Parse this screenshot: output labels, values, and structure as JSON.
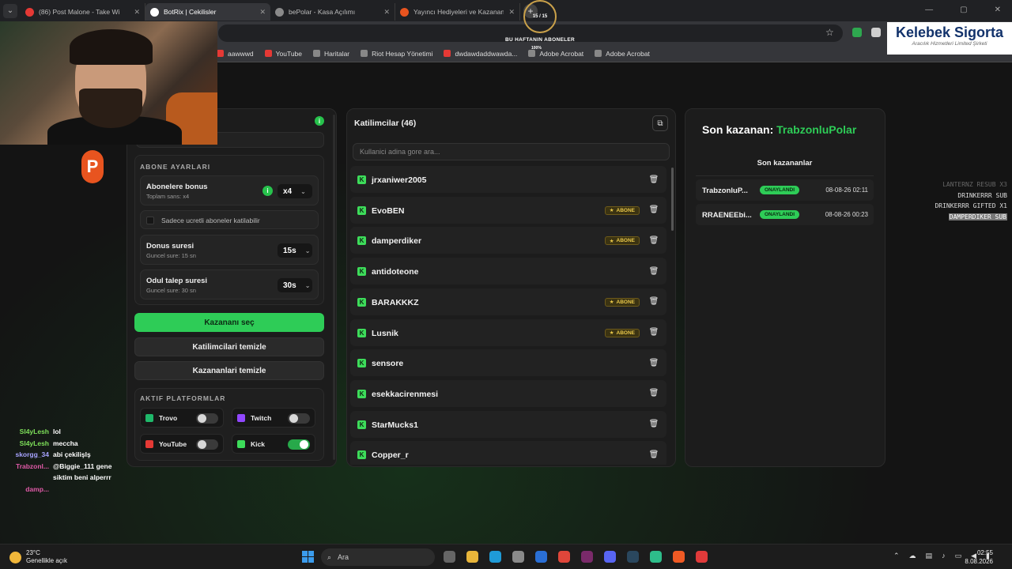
{
  "browser": {
    "tabs": [
      {
        "label": "(86) Post Malone - Take Wi",
        "color": "#e53935",
        "active": false
      },
      {
        "label": "BotRix | Cekilisler",
        "color": "#ffffff",
        "active": true
      },
      {
        "label": "bePolar - Kasa Açılımı",
        "color": "#8a8a8a",
        "active": false
      },
      {
        "label": "Yayıncı Hediyeleri ve Kazananla",
        "color": "#e8541f",
        "active": false
      }
    ],
    "new_tab": "+",
    "bookmarks": [
      {
        "label": "aawwwd",
        "color": "#e53935"
      },
      {
        "label": "YouTube",
        "color": "#e53935"
      },
      {
        "label": "Haritalar",
        "color": "#888888"
      },
      {
        "label": "Riot Hesap Yönetimi",
        "color": "#888888"
      },
      {
        "label": "dwdawdaddwawda...",
        "color": "#e53935"
      },
      {
        "label": "Adobe Acrobat",
        "color": "#888888"
      },
      {
        "label": "Adobe Acrobat",
        "color": "#888888"
      }
    ]
  },
  "overlay": {
    "goal_counter": "15 / 15",
    "goal_caption": "BU HAFTANIN ABONELER",
    "goal_percent": "100%",
    "sponsor_name": "Kelebek Sigorta",
    "sponsor_sub": "Aracılık Hizmetleri Limited Şirketi",
    "logo_letter": "P"
  },
  "settings": {
    "sub_section_title": "ABONE AYARLARI",
    "sub_bonus_label": "Abonelere bonus",
    "sub_bonus_sub": "Toplam sans: x4",
    "sub_bonus_value": "x4",
    "paid_only_label": "Sadece ucretli aboneler katilabilir",
    "spin_label": "Donus suresi",
    "spin_sub": "Guncel sure: 15 sn",
    "spin_value": "15s",
    "claim_label": "Odul talep suresi",
    "claim_sub": "Guncel sure: 30 sn",
    "claim_value": "30s",
    "pick_winner": "Kazananı seç",
    "clear_participants": "Katilimcilari temizle",
    "clear_winners": "Kazananlari temizle",
    "platforms_title": "AKTIF PLATFORMLAR",
    "platforms": [
      {
        "name": "Trovo",
        "color": "#1fb86a",
        "on": false
      },
      {
        "name": "Twitch",
        "color": "#9147ff",
        "on": false
      },
      {
        "name": "YouTube",
        "color": "#e53935",
        "on": false
      },
      {
        "name": "Kick",
        "color": "#3ddc5a",
        "on": true
      }
    ]
  },
  "participants": {
    "title": "Katilimcilar (46)",
    "search_placeholder": "Kullanici adina gore ara...",
    "badge_label": "ABONE",
    "rows": [
      {
        "name": "jrxaniwer2005",
        "sub": false
      },
      {
        "name": "EvoBEN",
        "sub": true
      },
      {
        "name": "damperdiker",
        "sub": true
      },
      {
        "name": "antidoteone",
        "sub": false
      },
      {
        "name": "BARAKKKZ",
        "sub": true
      },
      {
        "name": "Lusnik",
        "sub": true
      },
      {
        "name": "sensore",
        "sub": false
      },
      {
        "name": "esekkacirenmesi",
        "sub": false
      },
      {
        "name": "StarMucks1",
        "sub": false
      },
      {
        "name": "Copper_r",
        "sub": false
      }
    ]
  },
  "winners": {
    "last_label": "Son kazanan:",
    "last_name": "TrabzonluPolar",
    "list_title": "Son kazananlar",
    "status_label": "ONAYLANDI",
    "rows": [
      {
        "name": "TrabzonluP...",
        "date": "08-08-26 02:11"
      },
      {
        "name": "RRAENEEbi...",
        "date": "08-08-26 00:23"
      }
    ]
  },
  "events": [
    "LANTERNZ RESUB X3",
    "DRINKERRR SUB",
    "DRINKERRR GIFTED X1",
    "DAMPERDIKER SUB"
  ],
  "chat": [
    {
      "user": "Sl4yLesh",
      "color": "#7ee05a",
      "msg": "lol"
    },
    {
      "user": "Sl4yLesh",
      "color": "#7ee05a",
      "msg": "meccha"
    },
    {
      "user": "skorgg_34",
      "color": "#a7a3ff",
      "msg": "abi çekilişlş"
    },
    {
      "user": "Trabzonl...",
      "color": "#e05aa8",
      "msg": "@Biggie_111 gene siktim beni alperrr"
    },
    {
      "user": "damp...",
      "color": "#e05aa8",
      "msg": ""
    }
  ],
  "taskbar": {
    "temp": "23°C",
    "weather": "Genellikle açık",
    "search": "Ara",
    "time": "02:55",
    "date": "8.08.2026"
  }
}
